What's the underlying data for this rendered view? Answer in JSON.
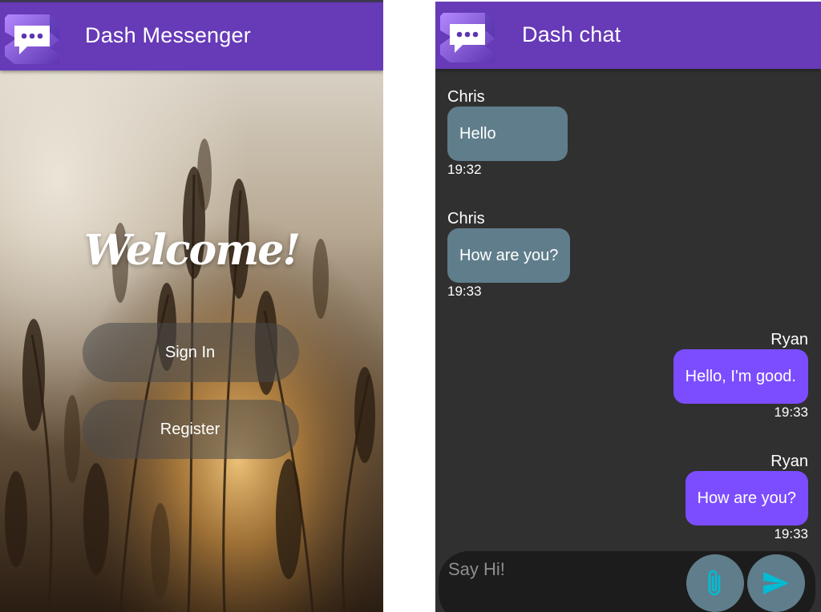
{
  "left_screen": {
    "app_bar": {
      "title": "Dash Messenger",
      "logo_icon": "chat-bubble-logo-icon"
    },
    "welcome_text": "Welcome!",
    "buttons": {
      "sign_in": "Sign In",
      "register": "Register"
    },
    "background": "wheat-field-sunset-photo"
  },
  "right_screen": {
    "app_bar": {
      "title": "Dash chat",
      "logo_icon": "chat-bubble-logo-icon"
    },
    "messages": [
      {
        "sender": "Chris",
        "text": "Hello",
        "time": "19:32",
        "direction": "incoming"
      },
      {
        "sender": "Chris",
        "text": "How are you?",
        "time": "19:33",
        "direction": "incoming"
      },
      {
        "sender": "Ryan",
        "text": "Hello, I'm good.",
        "time": "19:33",
        "direction": "outgoing"
      },
      {
        "sender": "Ryan",
        "text": "How are you?",
        "time": "19:33",
        "direction": "outgoing"
      }
    ],
    "composer": {
      "placeholder": "Say Hi!",
      "attach_icon": "paperclip-icon",
      "send_icon": "send-icon"
    }
  },
  "colors": {
    "app_bar": "#673ab7",
    "incoming_bubble": "#607d8b",
    "outgoing_bubble": "#7c4dff",
    "chat_background": "#303030",
    "icon_accent": "#00bcd4"
  }
}
